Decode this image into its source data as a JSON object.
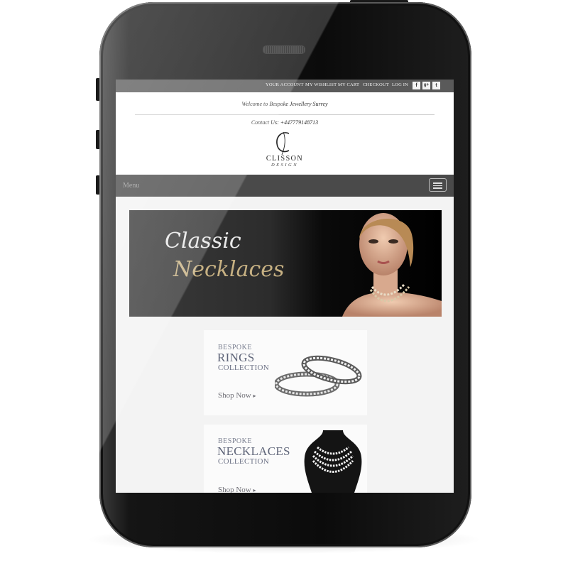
{
  "topbar": {
    "links": [
      "YOUR ACCOUNT",
      "MY WISHLIST",
      "MY CART",
      "CHECKOUT",
      "LOG IN"
    ],
    "social": [
      {
        "icon": "facebook-icon",
        "glyph": "f"
      },
      {
        "icon": "google-plus-icon",
        "glyph": "g+"
      },
      {
        "icon": "twitter-icon",
        "glyph": "t"
      }
    ]
  },
  "header": {
    "welcome": "Welcome to Bespoke Jewellery Surrey",
    "contact": "Contact Us: +447779148713",
    "logo_name": "CLISSON",
    "logo_sub": "DESIGN"
  },
  "menu": {
    "label": "Menu",
    "toggle_icon": "hamburger-icon"
  },
  "hero": {
    "line1": "Classic",
    "line2": "Necklaces"
  },
  "promos": [
    {
      "line1": "BESPOKE",
      "line2": "RINGS",
      "line3": "COLLECTION",
      "cta": "Shop Now"
    },
    {
      "line1": "BESPOKE",
      "line2": "NECKLACES",
      "line3": "COLLECTION",
      "cta": "Shop Now"
    }
  ],
  "colors": {
    "topbar": "#5a5a5a",
    "menubar": "#4a4a4a",
    "hero_gold": "#c7b183",
    "promo_text": "#5e6478"
  }
}
